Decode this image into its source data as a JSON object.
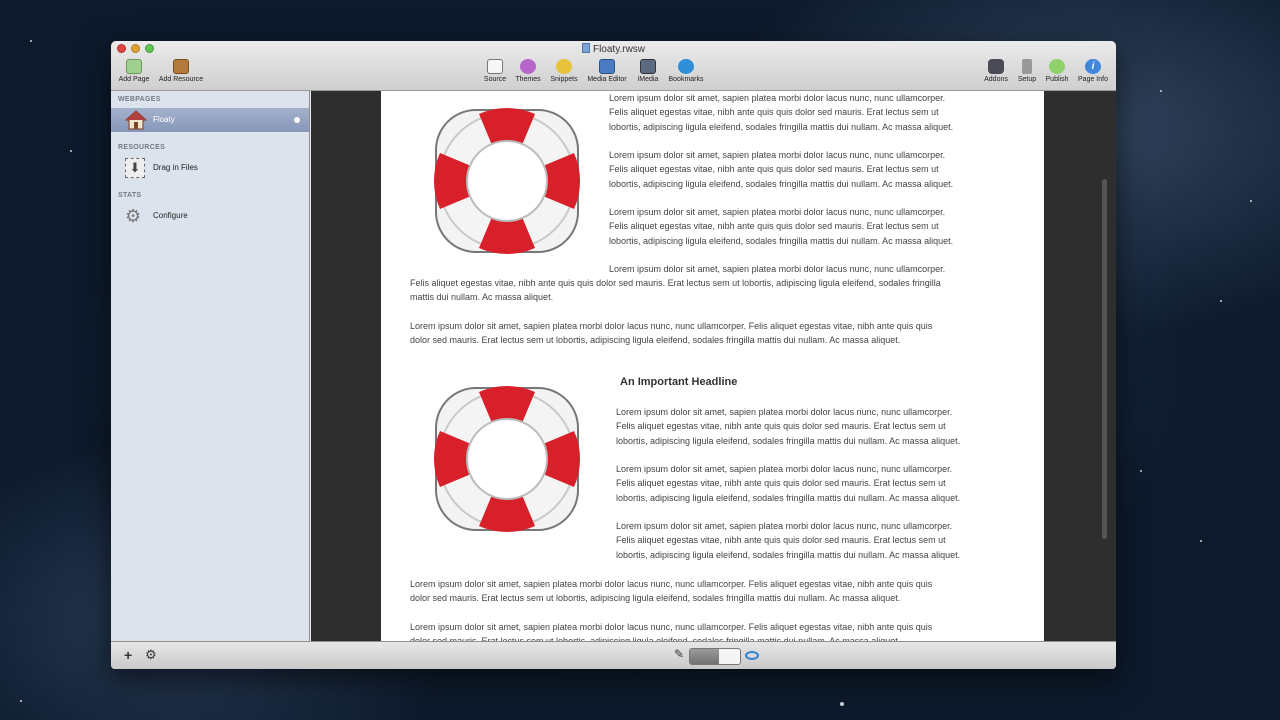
{
  "window": {
    "title": "Floaty.rwsw"
  },
  "toolbar": {
    "left": [
      "Add Page",
      "Add Resource"
    ],
    "center": [
      "Source",
      "Themes",
      "Snippets",
      "Media Editor",
      "iMedia",
      "Bookmarks"
    ],
    "right": [
      "Addons",
      "Setup",
      "Publish",
      "Page Info"
    ]
  },
  "sidebar": {
    "webpages_heading": "WEBPAGES",
    "page": "Floaty",
    "resources_heading": "RESOURCES",
    "resource": "Drag in Files",
    "stats_heading": "STATS",
    "stats": "Configure"
  },
  "content": {
    "para3": "Lorem ipsum dolor sit amet, sapien platea morbi dolor lacus nunc, nunc ullamcorper.\nFelis aliquet egestas vitae, nibh ante quis quis dolor sed mauris. Erat lectus sem ut\nlobortis, adipiscing ligula eleifend, sodales fringilla mattis dui nullam. Ac massa aliquet.",
    "wrap_first": "Lorem ipsum dolor sit amet, sapien platea morbi dolor lacus nunc, nunc ullamcorper.",
    "wrap_rest": "Felis aliquet egestas vitae, nibh ante quis quis dolor sed mauris. Erat lectus sem ut lobortis, adipiscing ligula eleifend, sodales fringilla\nmattis dui nullam. Ac massa aliquet.",
    "full": "Lorem ipsum dolor sit amet, sapien platea morbi dolor lacus nunc, nunc ullamcorper. Felis aliquet egestas vitae, nibh ante quis quis\ndolor sed mauris. Erat lectus sem ut lobortis, adipiscing ligula eleifend, sodales fringilla mattis dui nullam. Ac massa aliquet.",
    "headline": "An Important Headline",
    "cut": "Lorem ipsum dolor sit amet, sapien platea morbi dolor lacus nunc, nunc ullamcorper. Felis aliquet egestas vitae, nibh ante quis quis\ndolor sed mauris. Erat lectus sem ut lobortis, adipiscing ligula eleifend, sodales fringilla mattis dui nullam. Ac massa aliquet."
  }
}
